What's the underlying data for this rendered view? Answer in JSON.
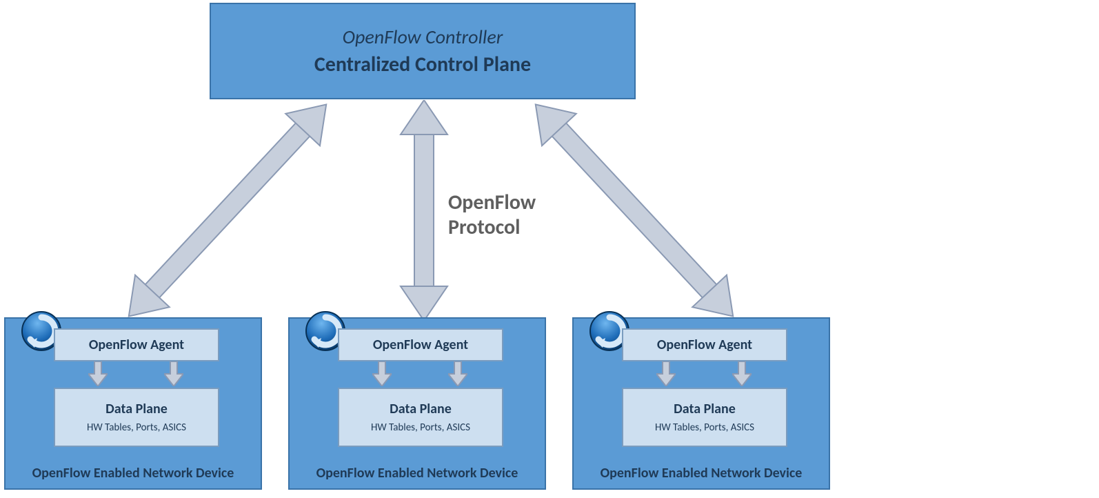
{
  "controller": {
    "title": "OpenFlow Controller",
    "subtitle": "Centralized Control Plane"
  },
  "protocol": {
    "line1": "OpenFlow",
    "line2": "Protocol"
  },
  "devices": [
    {
      "agent": "OpenFlow Agent",
      "dataplane_title": "Data Plane",
      "dataplane_sub": "HW Tables, Ports, ASICS",
      "label": "OpenFlow Enabled Network Device"
    },
    {
      "agent": "OpenFlow Agent",
      "dataplane_title": "Data Plane",
      "dataplane_sub": "HW Tables, Ports, ASICS",
      "label": "OpenFlow Enabled Network Device"
    },
    {
      "agent": "OpenFlow Agent",
      "dataplane_title": "Data Plane",
      "dataplane_sub": "HW Tables, Ports, ASICS",
      "label": "OpenFlow Enabled Network Device"
    }
  ]
}
